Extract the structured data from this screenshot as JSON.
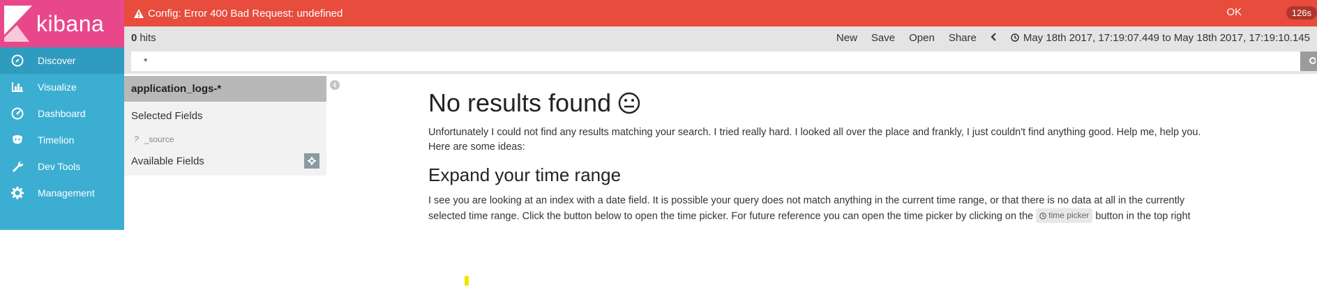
{
  "app": {
    "logo_text": "kibana",
    "brand_colors": {
      "logo_bg": "#e8488b",
      "sidebar_bg": "#3caed2",
      "error_bg": "#e74c3c"
    }
  },
  "sidebar": {
    "items": [
      {
        "label": "Discover",
        "icon": "compass-icon",
        "active": true
      },
      {
        "label": "Visualize",
        "icon": "bar-chart-icon",
        "active": false
      },
      {
        "label": "Dashboard",
        "icon": "dashboard-icon",
        "active": false
      },
      {
        "label": "Timelion",
        "icon": "timelion-icon",
        "active": false
      },
      {
        "label": "Dev Tools",
        "icon": "wrench-icon",
        "active": false
      },
      {
        "label": "Management",
        "icon": "gear-icon",
        "active": false
      }
    ]
  },
  "error_bar": {
    "message": "Config: Error 400 Bad Request: undefined",
    "ok_label": "OK",
    "count_badge": "126s"
  },
  "toolbar": {
    "hits_count": "0",
    "hits_label": "hits",
    "new_label": "New",
    "save_label": "Save",
    "open_label": "Open",
    "share_label": "Share",
    "time_range": "May 18th 2017, 17:19:07.449 to May 18th 2017, 17:19:10.145"
  },
  "search": {
    "value": "*"
  },
  "field_panel": {
    "index_pattern": "application_logs-*",
    "selected_fields_title": "Selected Fields",
    "selected_fields": [
      {
        "type": "?",
        "name": "_source"
      }
    ],
    "available_fields_title": "Available Fields"
  },
  "main": {
    "title": "No results found",
    "intro": "Unfortunately I could not find any results matching your search. I tried really hard. I looked all over the place and frankly, I just couldn't find anything good. Help me, help you. Here are some ideas:",
    "expand_title": "Expand your time range",
    "expand_text_before": "I see you are looking at an index with a date field. It is possible your query does not match anything in the current time range, or that there is no data at all in the currently selected time range. Click the button below to open the time picker. For future reference you can open the time picker by clicking on the",
    "time_picker_label": "time picker",
    "expand_text_after": "button in the top right"
  }
}
